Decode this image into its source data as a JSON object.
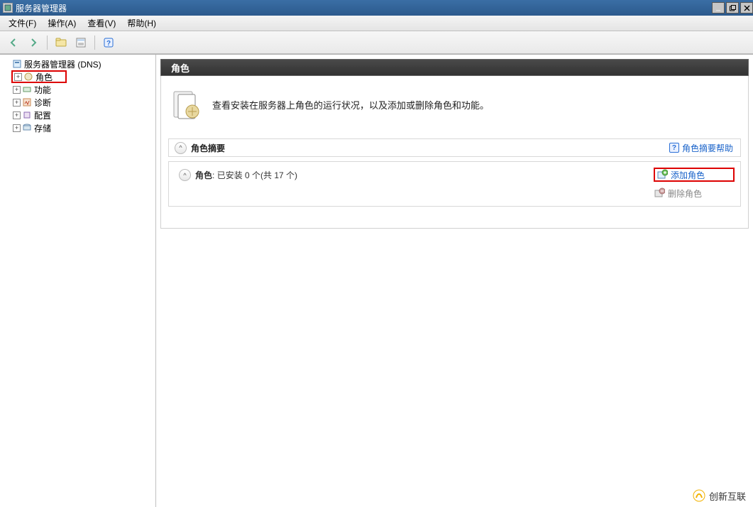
{
  "window": {
    "title": "服务器管理器"
  },
  "menubar": {
    "file": "文件(F)",
    "action": "操作(A)",
    "view": "查看(V)",
    "help": "帮助(H)"
  },
  "toolbar": {
    "back_icon": "back-icon",
    "forward_icon": "forward-icon",
    "up_icon": "up-icon",
    "refresh_icon": "refresh-icon",
    "help_icon": "help-icon"
  },
  "tree": {
    "root": "服务器管理器  (DNS)",
    "items": [
      {
        "label": "角色"
      },
      {
        "label": "功能"
      },
      {
        "label": "诊断"
      },
      {
        "label": "配置"
      },
      {
        "label": "存储"
      }
    ]
  },
  "content": {
    "header": "角色",
    "intro": "查看安装在服务器上角色的运行状况，以及添加或删除角色和功能。",
    "summary_title": "角色摘要",
    "summary_help": "角色摘要帮助",
    "status_label": "角色",
    "status_sep": ":",
    "status_value": "已安装 0 个(共 17 个)",
    "add_role": "添加角色",
    "remove_role": "删除角色"
  },
  "watermark": {
    "text": "创新互联"
  }
}
